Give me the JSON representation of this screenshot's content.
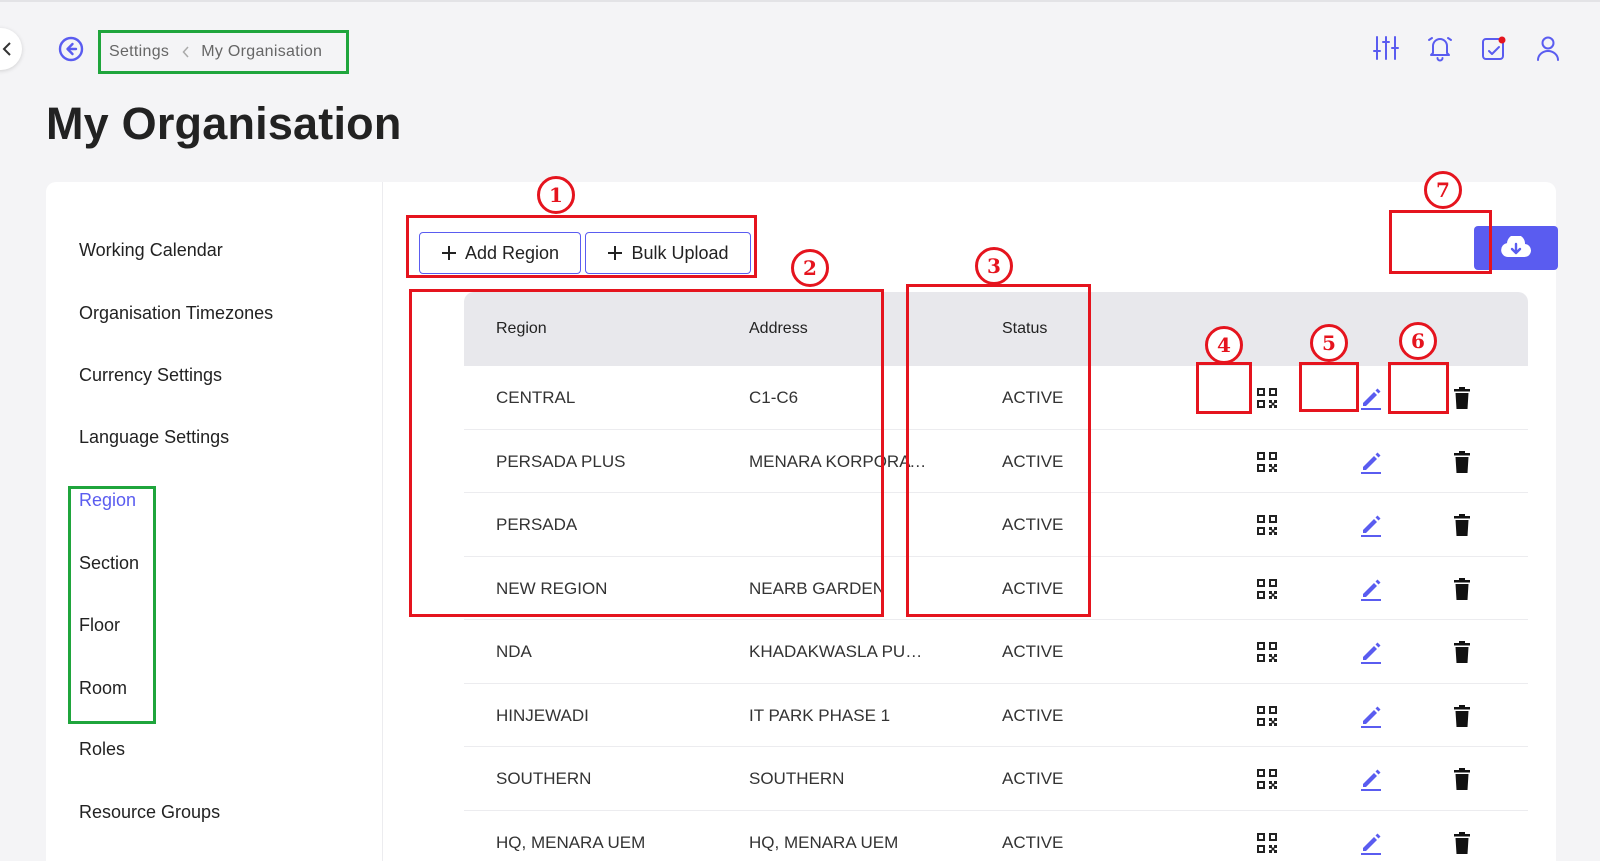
{
  "breadcrumb": {
    "parent": "Settings",
    "current": "My Organisation"
  },
  "page": {
    "title": "My Organisation"
  },
  "sidebar": {
    "items": [
      {
        "label": "Working Calendar",
        "active": false
      },
      {
        "label": "Organisation Timezones",
        "active": false
      },
      {
        "label": "Currency Settings",
        "active": false
      },
      {
        "label": "Language Settings",
        "active": false
      },
      {
        "label": "Region",
        "active": true
      },
      {
        "label": "Section",
        "active": false
      },
      {
        "label": "Floor",
        "active": false
      },
      {
        "label": "Room",
        "active": false
      },
      {
        "label": "Roles",
        "active": false
      },
      {
        "label": "Resource Groups",
        "active": false
      }
    ]
  },
  "toolbar": {
    "add_region": "Add Region",
    "bulk_upload": "Bulk Upload",
    "download_icon": "cloud-download-icon"
  },
  "table": {
    "headers": {
      "region": "Region",
      "address": "Address",
      "status": "Status"
    },
    "rows": [
      {
        "region": "CENTRAL",
        "address": "C1-C6",
        "status": "ACTIVE"
      },
      {
        "region": "PERSADA PLUS",
        "address": "MENARA KORPORAT,...",
        "status": "ACTIVE"
      },
      {
        "region": "PERSADA",
        "address": "",
        "status": "ACTIVE"
      },
      {
        "region": "NEW REGION",
        "address": "NEARB GARDEN",
        "status": "ACTIVE"
      },
      {
        "region": "NDA",
        "address": "KHADAKWASLA PUNE",
        "status": "ACTIVE"
      },
      {
        "region": "HINJEWADI",
        "address": "IT PARK PHASE 1",
        "status": "ACTIVE"
      },
      {
        "region": "SOUTHERN",
        "address": "SOUTHERN",
        "status": "ACTIVE"
      },
      {
        "region": "HQ, MENARA UEM",
        "address": "HQ, MENARA UEM",
        "status": "ACTIVE"
      }
    ],
    "row_actions": [
      "qr-code-icon",
      "edit-icon",
      "delete-icon"
    ]
  },
  "annotations": {
    "callouts": [
      "1",
      "2",
      "3",
      "4",
      "5",
      "6",
      "7"
    ]
  },
  "colors": {
    "accent": "#5a5cf0",
    "annotation_red": "#e5141e",
    "annotation_green": "#1fa53c",
    "header_bg": "#e8e8ec"
  }
}
